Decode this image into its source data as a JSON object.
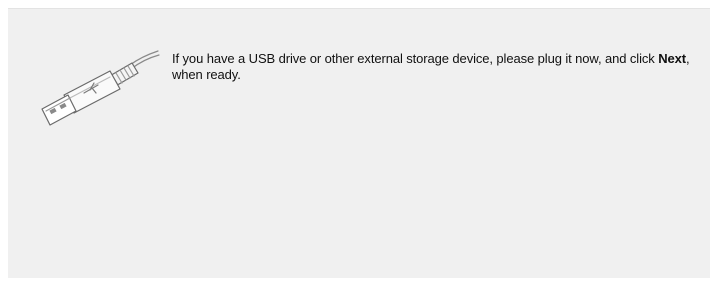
{
  "wizard": {
    "icon": "usb-drive-icon",
    "message": {
      "before_bold": "If you have a USB drive or other external storage device, please plug it now, and click ",
      "bold": "Next",
      "after_bold": ", when ready."
    }
  },
  "colors": {
    "panel_background": "#f0f0f0",
    "page_background": "#ffffff",
    "text": "#111111"
  }
}
